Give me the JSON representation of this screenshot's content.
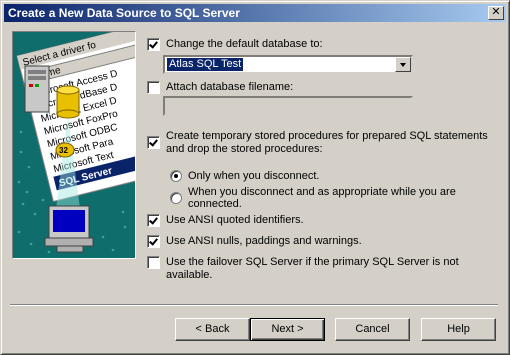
{
  "window": {
    "title": "Create a New Data Source to SQL Server",
    "close_glyph": "✕"
  },
  "illustration": {
    "driver_header": "Select a driver fo",
    "name_column": "Name",
    "drivers": [
      "Microsoft Access D",
      "Microsoft dBase D",
      "Microsoft Excel D",
      "Microsoft FoxPro",
      "Microsoft ODBC",
      "Microsoft Para",
      "Microsoft Text",
      "SQL Server"
    ]
  },
  "options": {
    "change_default_db": {
      "checked": true,
      "label": "Change the default database to:"
    },
    "database_select": {
      "value": "Atlas SQL Test"
    },
    "attach_filename": {
      "checked": false,
      "label": "Attach database filename:"
    },
    "create_temp_procs": {
      "checked": true,
      "line1": "Create temporary stored procedures for prepared SQL statements",
      "line2": "and drop the stored procedures:"
    },
    "radio_only_disconnect": {
      "checked": true,
      "label": "Only when you disconnect."
    },
    "radio_when_appropriate": {
      "checked": false,
      "line1": "When you disconnect and as appropriate while you are",
      "line2": "connected."
    },
    "ansi_quoted": {
      "checked": true,
      "label": "Use ANSI quoted identifiers."
    },
    "ansi_nulls": {
      "checked": true,
      "label": "Use ANSI nulls, paddings and warnings."
    },
    "failover": {
      "checked": false,
      "line1": "Use the failover SQL Server if the primary SQL Server is not",
      "line2": "available."
    }
  },
  "buttons": {
    "back": "< Back",
    "next": "Next >",
    "cancel": "Cancel",
    "help": "Help"
  }
}
